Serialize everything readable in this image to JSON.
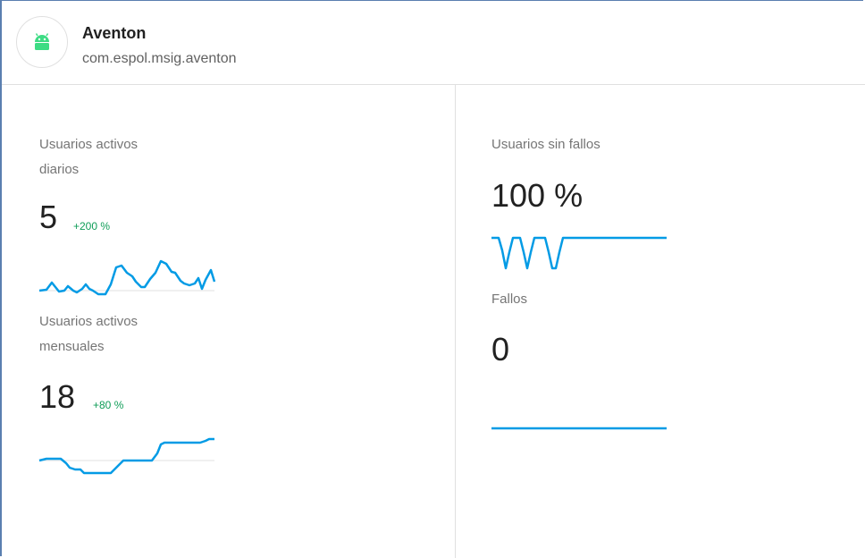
{
  "app": {
    "name": "Aventon",
    "package": "com.espol.msig.aventon",
    "icon": "android-icon"
  },
  "metrics": {
    "daily_active": {
      "label_line1": "Usuarios activos",
      "label_line2": "diarios",
      "value": "5",
      "change": "+200 %"
    },
    "monthly_active": {
      "label_line1": "Usuarios activos",
      "label_line2": "mensuales",
      "value": "18",
      "change": "+80 %"
    },
    "crash_free": {
      "label": "Usuarios sin fallos",
      "value": "100 %"
    },
    "crashes": {
      "label": "Fallos",
      "value": "0"
    }
  },
  "colors": {
    "accent": "#039be5",
    "positive": "#0f9d58",
    "android_green": "#3ddc84"
  }
}
